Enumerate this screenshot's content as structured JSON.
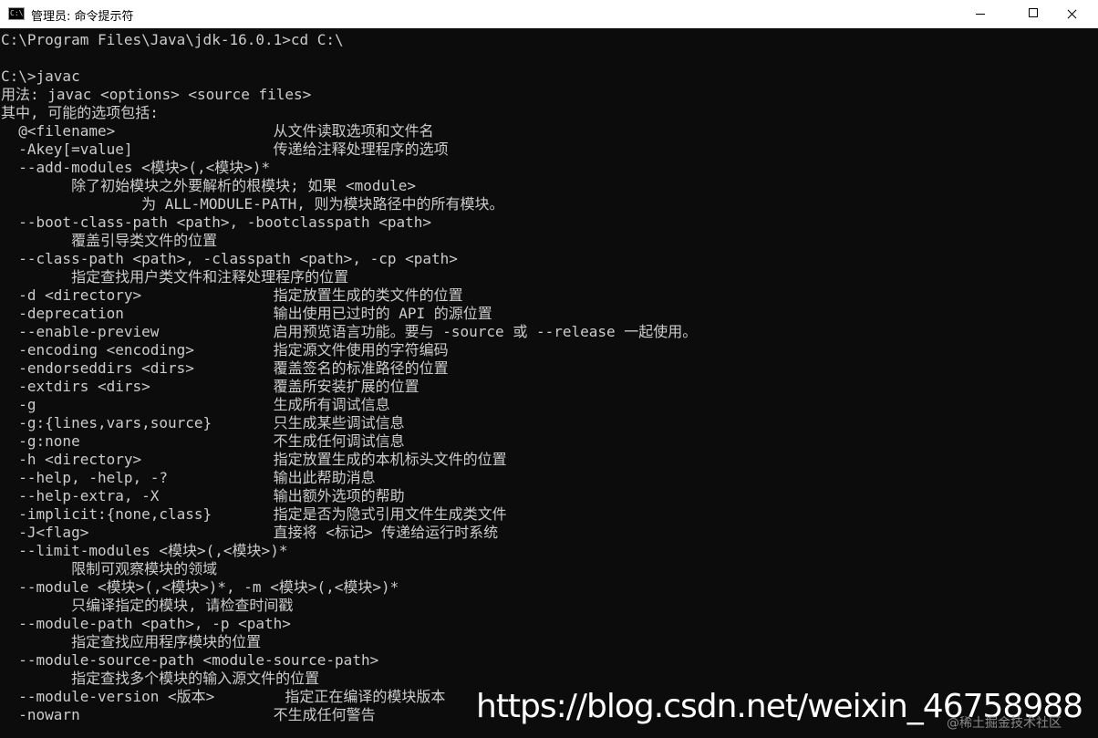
{
  "window": {
    "title": "管理员: 命令提示符",
    "icon": "cmd-console-icon",
    "icon_text": "C:\\."
  },
  "console": {
    "lines": [
      "C:\\Program Files\\Java\\jdk-16.0.1>cd C:\\",
      "",
      "C:\\>javac",
      "用法: javac <options> <source files>",
      "其中, 可能的选项包括:",
      "  @<filename>                  从文件读取选项和文件名",
      "  -Akey[=value]                传递给注释处理程序的选项",
      "  --add-modules <模块>(,<模块>)*",
      "        除了初始模块之外要解析的根模块; 如果 <module>",
      "                为 ALL-MODULE-PATH, 则为模块路径中的所有模块。",
      "  --boot-class-path <path>, -bootclasspath <path>",
      "        覆盖引导类文件的位置",
      "  --class-path <path>, -classpath <path>, -cp <path>",
      "        指定查找用户类文件和注释处理程序的位置",
      "  -d <directory>               指定放置生成的类文件的位置",
      "  -deprecation                 输出使用已过时的 API 的源位置",
      "  --enable-preview             启用预览语言功能。要与 -source 或 --release 一起使用。",
      "  -encoding <encoding>         指定源文件使用的字符编码",
      "  -endorseddirs <dirs>         覆盖签名的标准路径的位置",
      "  -extdirs <dirs>              覆盖所安装扩展的位置",
      "  -g                           生成所有调试信息",
      "  -g:{lines,vars,source}       只生成某些调试信息",
      "  -g:none                      不生成任何调试信息",
      "  -h <directory>               指定放置生成的本机标头文件的位置",
      "  --help, -help, -?            输出此帮助消息",
      "  --help-extra, -X             输出额外选项的帮助",
      "  -implicit:{none,class}       指定是否为隐式引用文件生成类文件",
      "  -J<flag>                     直接将 <标记> 传递给运行时系统",
      "  --limit-modules <模块>(,<模块>)*",
      "        限制可观察模块的领域",
      "  --module <模块>(,<模块>)*, -m <模块>(,<模块>)*",
      "        只编译指定的模块, 请检查时间戳",
      "  --module-path <path>, -p <path>",
      "        指定查找应用程序模块的位置",
      "  --module-source-path <module-source-path>",
      "        指定查找多个模块的输入源文件的位置",
      "  --module-version <版本>        指定正在编译的模块版本",
      "  -nowarn                      不生成任何警告"
    ]
  },
  "watermark": {
    "url": "https://blog.csdn.net/weixin_46758988",
    "small": "@稀土掘金技术社区"
  },
  "colors": {
    "console_background": "#0c0c0c",
    "console_text": "#cccccc",
    "titlebar_background": "#ffffff"
  }
}
